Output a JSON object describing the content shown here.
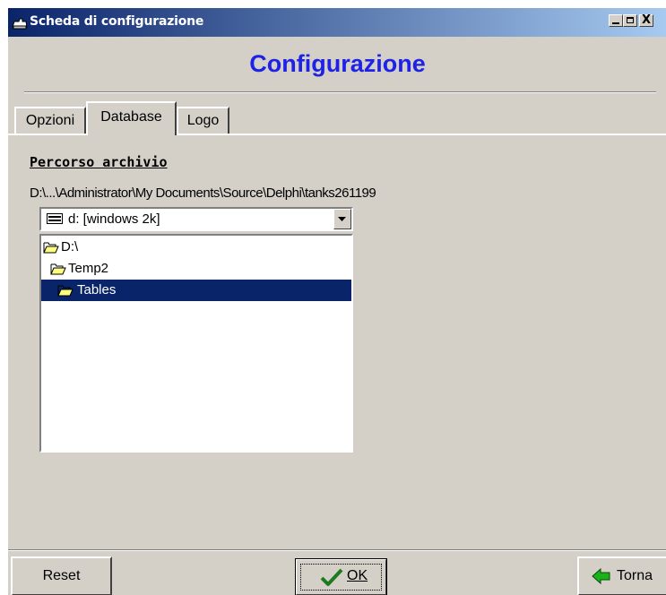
{
  "window": {
    "title": "Scheda di configurazione",
    "minimize_glyph": "_",
    "restore_glyph": "□",
    "close_glyph": "X"
  },
  "header": {
    "title": "Configurazione",
    "title_color": "#1e22e6"
  },
  "tabs": [
    {
      "label": "Opzioni",
      "active": false
    },
    {
      "label": "Database",
      "active": true
    },
    {
      "label": "Logo",
      "active": false
    }
  ],
  "database": {
    "section_label": "Percorso archivio",
    "path": "D:\\...\\Administrator\\My Documents\\Source\\Delphi\\tanks261199",
    "drive_combo": {
      "value": "d: [windows 2k]",
      "icon": "drive-icon"
    },
    "folders": [
      {
        "label": "D:\\",
        "icon": "open-folder-icon",
        "selected": false
      },
      {
        "label": "Temp2",
        "icon": "open-folder-icon",
        "selected": false
      },
      {
        "label": "Tables",
        "icon": "open-folder-icon",
        "selected": true
      }
    ]
  },
  "buttons": {
    "reset": "Reset",
    "ok": "OK",
    "torna": "Torna"
  },
  "colors": {
    "titlebar_start": "#0a246a",
    "titlebar_end": "#a6caf0",
    "selection": "#0a246a",
    "face": "#d4d0c8"
  }
}
